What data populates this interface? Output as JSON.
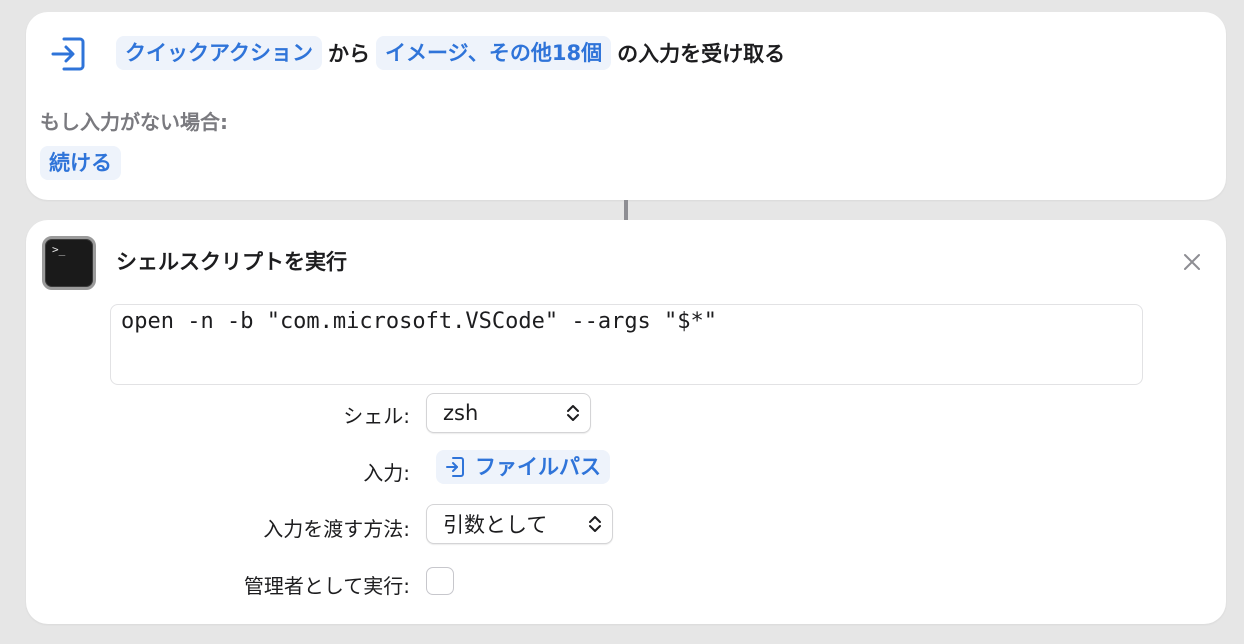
{
  "receive": {
    "source_token": "クイックアクション",
    "from_text": "から",
    "types_token": "イメージ、その他18個",
    "suffix_text": "の入力を受け取る",
    "no_input_label": "もし入力がない場合:",
    "continue_token": "続ける"
  },
  "shell_action": {
    "title": "シェルスクリプトを実行",
    "script": "open -n -b \"com.microsoft.VSCode\" --args \"$*\"",
    "shell_label": "シェル:",
    "shell_value": "zsh",
    "input_label": "入力:",
    "input_value": "ファイルパス",
    "pass_input_label": "入力を渡す方法:",
    "pass_input_value": "引数として",
    "admin_label": "管理者として実行:",
    "admin_checked": false
  },
  "icons": {
    "receive": "input-arrow-icon",
    "terminal": "terminal-icon",
    "close": "close-icon",
    "chevron": "chevron-updown-icon"
  },
  "colors": {
    "accent": "#2f74d9",
    "token_bg": "#eef3fb",
    "background": "#e6e6e6",
    "card": "#ffffff"
  }
}
